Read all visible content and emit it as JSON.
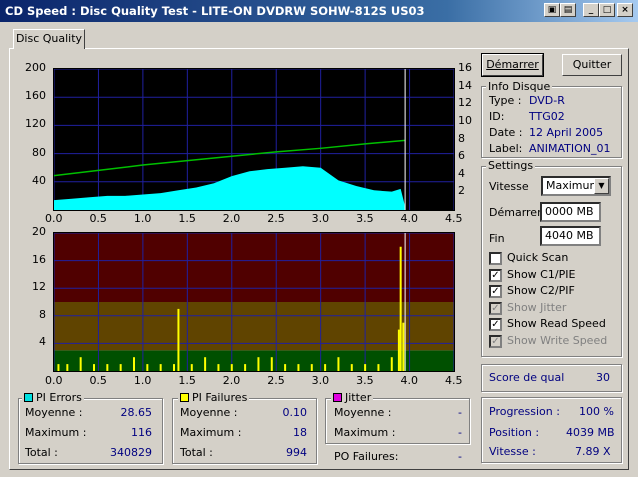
{
  "window": {
    "title": "CD Speed : Disc Quality Test - LITE-ON DVDRW SOHW-812S  US03"
  },
  "tab": {
    "label": "Disc Quality"
  },
  "buttons": {
    "start": "Démarrer",
    "quit": "Quitter"
  },
  "disc_info": {
    "title": "Info Disque",
    "type_label": "Type :",
    "type_value": "DVD-R",
    "id_label": "ID:",
    "id_value": "TTG02",
    "date_label": "Date :",
    "date_value": "12 April 2005",
    "label_label": "Label:",
    "label_value": "ANIMATION_01"
  },
  "settings": {
    "title": "Settings",
    "speed_label": "Vitesse",
    "speed_value": "Maximum",
    "start_label": "Démarrer",
    "start_value": "0000 MB",
    "end_label": "Fin",
    "end_value": "4040 MB",
    "checkboxes": [
      {
        "label": "Quick Scan",
        "checked": false,
        "enabled": true
      },
      {
        "label": "Show C1/PIE",
        "checked": true,
        "enabled": true
      },
      {
        "label": "Show C2/PIF",
        "checked": true,
        "enabled": true
      },
      {
        "label": "Show Jitter",
        "checked": true,
        "enabled": false
      },
      {
        "label": "Show Read Speed",
        "checked": true,
        "enabled": true
      },
      {
        "label": "Show Write Speed",
        "checked": true,
        "enabled": false
      }
    ]
  },
  "score": {
    "label": "Score de qual",
    "value": "30"
  },
  "progress": {
    "progression_label": "Progression :",
    "progression_value": "100 %",
    "position_label": "Position :",
    "position_value": "4039 MB",
    "speed_label": "Vitesse :",
    "speed_value": "7.89 X"
  },
  "pi_errors": {
    "title": "PI Errors",
    "color": "#00e0e0",
    "avg_label": "Moyenne :",
    "avg_value": "28.65",
    "max_label": "Maximum :",
    "max_value": "116",
    "total_label": "Total :",
    "total_value": "340829"
  },
  "pi_failures": {
    "title": "PI Failures",
    "color": "#ffff00",
    "avg_label": "Moyenne :",
    "avg_value": "0.10",
    "max_label": "Maximum :",
    "max_value": "18",
    "total_label": "Total :",
    "total_value": "994"
  },
  "jitter": {
    "title": "Jitter",
    "color": "#e000e0",
    "avg_label": "Moyenne :",
    "avg_value": "-",
    "max_label": "Maximum :",
    "max_value": "-"
  },
  "po_failures": {
    "label": "PO Failures:",
    "value": "-"
  },
  "chart_data": [
    {
      "type": "area",
      "title": "",
      "x_ticks": [
        "0.0",
        "0.5",
        "1.0",
        "1.5",
        "2.0",
        "2.5",
        "3.0",
        "3.5",
        "4.0",
        "4.5"
      ],
      "y_ticks_left": [
        "200",
        "160",
        "120",
        "80",
        "40"
      ],
      "y_ticks_right": [
        "16",
        "14",
        "12",
        "10",
        "8",
        "6",
        "4",
        "2"
      ],
      "xlim": [
        0,
        4.5
      ],
      "ylim": [
        0,
        200
      ],
      "ylim_right": [
        0,
        16
      ],
      "grid": true,
      "series": [
        {
          "name": "PI Errors",
          "color": "#00ffff",
          "x": [
            0,
            0.2,
            0.4,
            0.6,
            0.8,
            1.0,
            1.2,
            1.4,
            1.6,
            1.8,
            2.0,
            2.2,
            2.4,
            2.6,
            2.8,
            3.0,
            3.2,
            3.4,
            3.6,
            3.8,
            3.9,
            3.95
          ],
          "values": [
            14,
            16,
            18,
            20,
            20,
            22,
            24,
            28,
            32,
            38,
            48,
            55,
            58,
            60,
            62,
            60,
            42,
            34,
            28,
            26,
            30,
            5
          ]
        },
        {
          "name": "Read Speed",
          "color": "#00c000",
          "axis": "right",
          "x": [
            0,
            0.5,
            1.0,
            1.5,
            2.0,
            2.5,
            3.0,
            3.5,
            3.95
          ],
          "values": [
            3.9,
            4.5,
            5.1,
            5.6,
            6.1,
            6.6,
            7.0,
            7.5,
            7.9
          ]
        }
      ]
    },
    {
      "type": "bar",
      "title": "",
      "x_ticks": [
        "0.0",
        "0.5",
        "1.0",
        "1.5",
        "2.0",
        "2.5",
        "3.0",
        "3.5",
        "4.0",
        "4.5"
      ],
      "y_ticks_left": [
        "20",
        "16",
        "12",
        "8",
        "4"
      ],
      "xlim": [
        0,
        4.5
      ],
      "ylim": [
        0,
        20
      ],
      "grid": true,
      "bands": [
        {
          "from": 0,
          "to": 3,
          "color": "#005000"
        },
        {
          "from": 3,
          "to": 10,
          "color": "#604400"
        },
        {
          "from": 10,
          "to": 20,
          "color": "#500000"
        }
      ],
      "series": [
        {
          "name": "PI Failures",
          "color": "#ffff00",
          "x": [
            0.05,
            0.15,
            0.3,
            0.45,
            0.6,
            0.75,
            0.9,
            1.05,
            1.2,
            1.35,
            1.4,
            1.55,
            1.7,
            1.85,
            2.0,
            2.15,
            2.3,
            2.45,
            2.6,
            2.75,
            2.9,
            3.05,
            3.2,
            3.35,
            3.5,
            3.65,
            3.8,
            3.88,
            3.9,
            3.93
          ],
          "values": [
            1,
            1,
            2,
            1,
            1,
            1,
            2,
            1,
            1,
            1,
            9,
            1,
            2,
            1,
            1,
            1,
            2,
            2,
            1,
            1,
            1,
            1,
            2,
            1,
            1,
            1,
            2,
            6,
            18,
            7
          ]
        }
      ]
    }
  ]
}
